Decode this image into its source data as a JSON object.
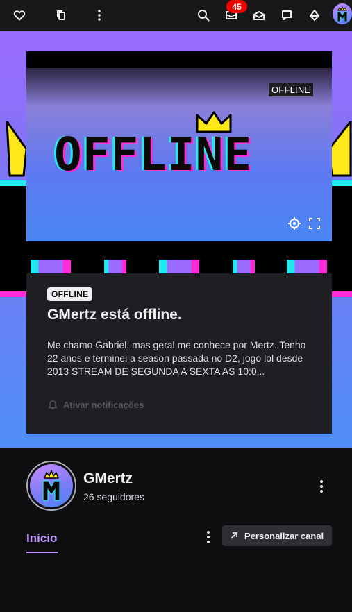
{
  "topbar": {
    "notifications_count": "45",
    "icons": [
      "heart-icon",
      "copy-icon",
      "more-vertical-icon",
      "search-icon",
      "inbox-icon",
      "mail-icon",
      "chat-icon",
      "prime-icon"
    ]
  },
  "player": {
    "offline_tag": "OFFLINE",
    "art_text": "OFFLINE"
  },
  "offline_card": {
    "pill": "OFFLINE",
    "title": "GMertz está offline.",
    "description": "Me chamo Gabriel, mas geral me conhece por Mertz. Tenho 22 anos e terminei a season passada no D2, jogo lol desde 2013 STREAM DE SEGUNDA A SEXTA AS 10:0...",
    "notify_label": "Ativar notificações"
  },
  "channel": {
    "name": "GMertz",
    "followers": "26 seguidores",
    "avatar_letter": "M"
  },
  "tabs": {
    "home": "Início"
  },
  "actions": {
    "customize": "Personalizar canal"
  },
  "colors": {
    "accent": "#bf94ff",
    "badge": "#eb0400",
    "cyan": "#22e8ef",
    "magenta": "#ff2bd6",
    "crown": "#ffe81a"
  }
}
